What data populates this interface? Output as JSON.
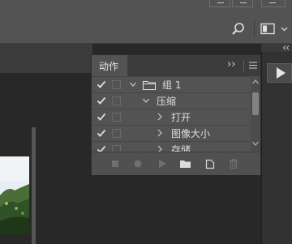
{
  "panel": {
    "tab_label": "动作",
    "expand_glyph": "››",
    "rows": [
      {
        "label": "组 1",
        "expanded": true
      },
      {
        "label": "压缩",
        "expanded": true
      },
      {
        "label": "打开",
        "expanded": false
      },
      {
        "label": "图像大小",
        "expanded": false
      },
      {
        "label": "存储",
        "expanded": false
      }
    ],
    "footer_icons": [
      "stop-icon",
      "record-icon",
      "play-icon",
      "new-set-icon",
      "new-action-icon",
      "delete-icon"
    ]
  },
  "icons": {
    "search": "search-icon",
    "workspace": "workspace-switcher-icon",
    "dock_expand": "double-chevron-left-icon",
    "dock_play": "actions-panel-icon"
  },
  "colors": {
    "panel_bg": "#535353",
    "workspace_bg": "#282828",
    "options_bar_bg": "#535353"
  }
}
